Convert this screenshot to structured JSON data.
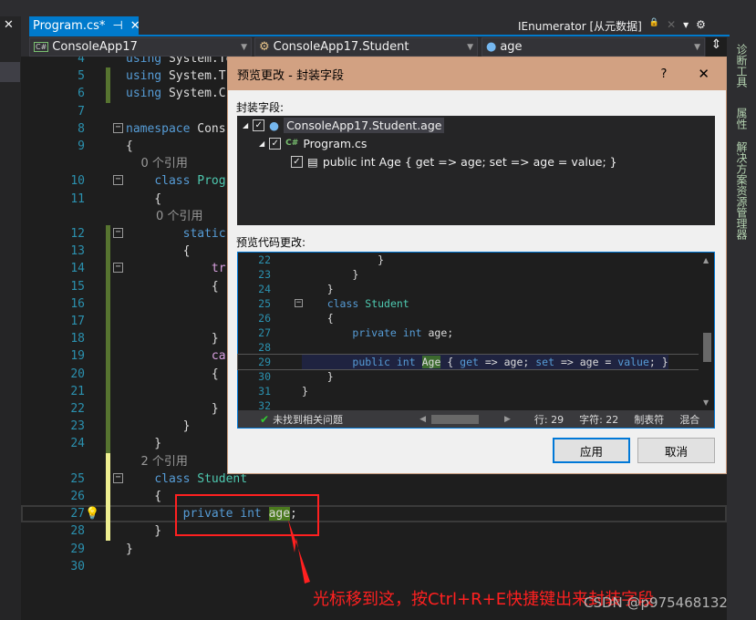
{
  "tab": {
    "title": "Program.cs*",
    "pin": "⊣",
    "close": "✕"
  },
  "toolbar_right": {
    "title": "IEnumerator [从元数据]",
    "lock": "🔒",
    "close": "✕",
    "dropdown": "▾",
    "gear": "⚙"
  },
  "nav": {
    "project": "ConsoleApp17",
    "class": "ConsoleApp17.Student",
    "member": "age",
    "split": "⇕"
  },
  "left_panel": {
    "close": "✕"
  },
  "sidebar": {
    "items": [
      "诊断工具",
      "属性",
      "解决方案资源管理器"
    ]
  },
  "editor": {
    "rows": [
      {
        "ln": "4",
        "code": "using System.Tex"
      },
      {
        "ln": "5",
        "code": "using System.T"
      },
      {
        "ln": "6",
        "code": "using System.C"
      },
      {
        "ln": "7",
        "code": ""
      },
      {
        "ln": "8",
        "code": "namespace Cons"
      },
      {
        "ln": "9",
        "code": "{"
      },
      {
        "ln": "",
        "code": "    0 个引用"
      },
      {
        "ln": "10",
        "code": "    class Prog"
      },
      {
        "ln": "11",
        "code": "    {"
      },
      {
        "ln": "",
        "code": "        0 个引用"
      },
      {
        "ln": "12",
        "code": "        static"
      },
      {
        "ln": "13",
        "code": "        {"
      },
      {
        "ln": "14",
        "code": "            tr"
      },
      {
        "ln": "15",
        "code": "            {"
      },
      {
        "ln": "16",
        "code": ""
      },
      {
        "ln": "17",
        "code": ""
      },
      {
        "ln": "18",
        "code": "            }"
      },
      {
        "ln": "19",
        "code": "            ca"
      },
      {
        "ln": "20",
        "code": "            {"
      },
      {
        "ln": "21",
        "code": ""
      },
      {
        "ln": "22",
        "code": "            }"
      },
      {
        "ln": "23",
        "code": "        }"
      },
      {
        "ln": "24",
        "code": "    }"
      },
      {
        "ln": "",
        "code": "    2 个引用"
      },
      {
        "ln": "25",
        "code": "    class Student"
      },
      {
        "ln": "26",
        "code": "    {"
      },
      {
        "ln": "27",
        "code": "        private int age;"
      },
      {
        "ln": "28",
        "code": "    }"
      },
      {
        "ln": "29",
        "code": "}"
      },
      {
        "ln": "30",
        "code": ""
      }
    ]
  },
  "dialog": {
    "title": "预览更改 - 封装字段",
    "help": "?",
    "close": "✕",
    "fields_label": "封装字段:",
    "tree": [
      {
        "label": "ConsoleApp17.Student.age",
        "checked": true
      },
      {
        "label": "Program.cs",
        "checked": true,
        "icon": "C#"
      },
      {
        "label": "public int Age { get => age; set => age = value; }",
        "checked": true
      }
    ],
    "preview_label": "预览代码更改:",
    "preview": [
      {
        "ln": "22",
        "code": "            }"
      },
      {
        "ln": "23",
        "code": "        }"
      },
      {
        "ln": "24",
        "code": "    }"
      },
      {
        "ln": "25",
        "code": "    class Student"
      },
      {
        "ln": "26",
        "code": "    {"
      },
      {
        "ln": "27",
        "code": "        private int age;"
      },
      {
        "ln": "28",
        "code": ""
      },
      {
        "ln": "29",
        "code": "        public int Age { get => age; set => age = value; }"
      },
      {
        "ln": "30",
        "code": "    }"
      },
      {
        "ln": "31",
        "code": "}"
      },
      {
        "ln": "32",
        "code": ""
      }
    ],
    "status": {
      "issues": "未找到相关问题",
      "line": "行: 29",
      "char": "字符: 22",
      "tabs": "制表符",
      "eol": "混合"
    },
    "apply": "应用",
    "cancel": "取消"
  },
  "annotation": {
    "text": "光标移到这，按Ctrl+R+E快捷键出来封装字段",
    "color": "#ff2020"
  },
  "watermark": "CSDN @p975468132",
  "colors": {
    "accent": "#007acc",
    "dialog_title": "#d2a182",
    "keyword": "#569cd6",
    "type": "#4ec9b0"
  }
}
